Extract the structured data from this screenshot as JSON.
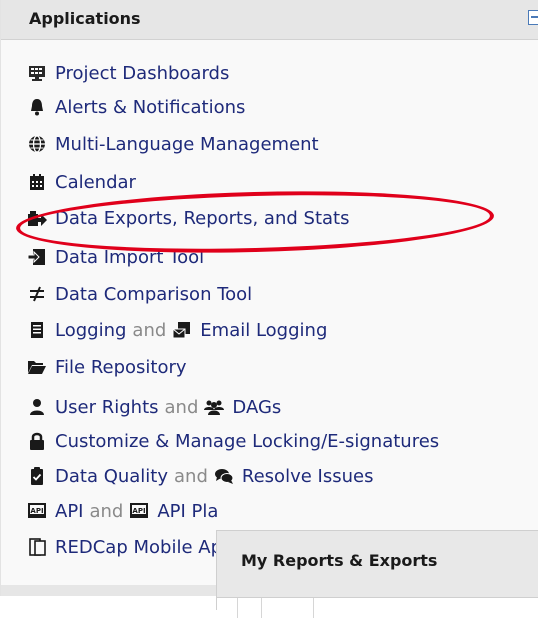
{
  "panel": {
    "title": "Applications",
    "collapse_icon": "minus-box-icon"
  },
  "items": [
    {
      "icon": "monitor-dashboard-icon",
      "label": "Project Dashboards"
    },
    {
      "icon": "bell-icon",
      "label": "Alerts & Notifications"
    },
    {
      "icon": "globe-icon",
      "label": "Multi-Language Management"
    },
    {
      "icon": "calendar-icon",
      "label": "Calendar"
    },
    {
      "icon": "export-icon",
      "label": "Data Exports, Reports, and Stats"
    },
    {
      "icon": "import-icon",
      "label": "Data Import Tool"
    },
    {
      "icon": "not-equal-icon",
      "label": "Data Comparison Tool"
    },
    {
      "icon": "log-icon",
      "label": "Logging",
      "conj": "and",
      "icon2": "email-log-icon",
      "label2": "Email Logging"
    },
    {
      "icon": "folder-open-icon",
      "label": "File Repository"
    },
    {
      "icon": "user-icon",
      "label": "User Rights",
      "conj": "and",
      "icon2": "users-icon",
      "label2": "DAGs"
    },
    {
      "icon": "lock-icon",
      "label": "Customize & Manage Locking/E-signatures"
    },
    {
      "icon": "clipboard-check-icon",
      "label": "Data Quality",
      "conj": "and",
      "icon2": "comments-icon",
      "label2": "Resolve Issues"
    },
    {
      "icon": "api-icon",
      "label": "API",
      "conj": "and",
      "icon2": "api-playground-icon",
      "label2": "API Playground"
    },
    {
      "icon": "mobile-app-icon",
      "label": "REDCap Mobile App"
    }
  ],
  "popup": {
    "title": "My Reports & Exports"
  },
  "highlight_color": "#e0001b",
  "link_color": "#1e2a7a"
}
